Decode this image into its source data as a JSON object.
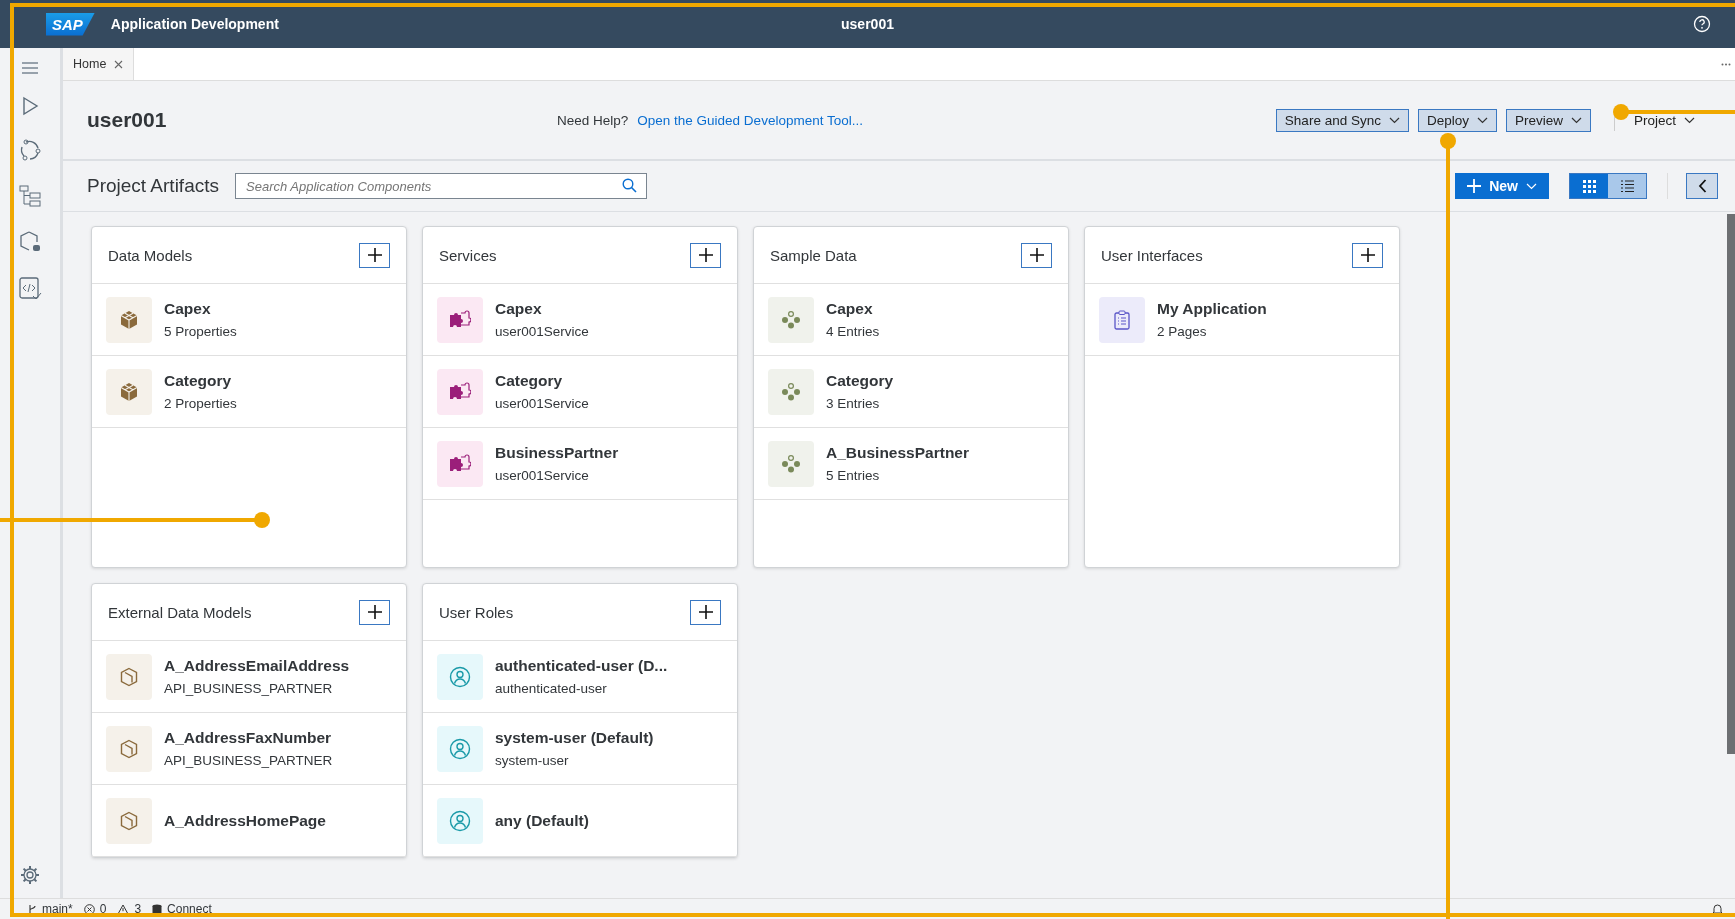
{
  "shell": {
    "logo": "SAP",
    "title": "Application Development",
    "user": "user001"
  },
  "tabs": [
    {
      "label": "Home",
      "selected": true
    }
  ],
  "header": {
    "title": "user001",
    "help_label": "Need Help?",
    "help_link": "Open the Guided Development Tool...",
    "buttons": [
      "Share and Sync",
      "Deploy",
      "Preview"
    ],
    "project_menu": "Project"
  },
  "artifacts": {
    "title": "Project Artifacts",
    "search_placeholder": "Search Application Components",
    "new_button": "New",
    "views": [
      {
        "kind": "grid",
        "selected": true
      },
      {
        "kind": "list",
        "selected": false
      }
    ]
  },
  "cards": [
    {
      "title": "Data Models",
      "kind": "entity",
      "items": [
        {
          "name": "Capex",
          "detail": "5 Properties"
        },
        {
          "name": "Category",
          "detail": "2 Properties"
        }
      ]
    },
    {
      "title": "Services",
      "kind": "service",
      "items": [
        {
          "name": "Capex",
          "detail": "user001Service"
        },
        {
          "name": "Category",
          "detail": "user001Service"
        },
        {
          "name": "BusinessPartner",
          "detail": "user001Service"
        }
      ]
    },
    {
      "title": "Sample Data",
      "kind": "sample",
      "items": [
        {
          "name": "Capex",
          "detail": "4 Entries"
        },
        {
          "name": "Category",
          "detail": "3 Entries"
        },
        {
          "name": "A_BusinessPartner",
          "detail": "5 Entries"
        }
      ]
    },
    {
      "title": "User Interfaces",
      "kind": "ui",
      "items": [
        {
          "name": "My Application",
          "detail": "2 Pages"
        }
      ]
    },
    {
      "title": "External Data Models",
      "kind": "external",
      "items": [
        {
          "name": "A_AddressEmailAddress",
          "detail": "API_BUSINESS_PARTNER"
        },
        {
          "name": "A_AddressFaxNumber",
          "detail": "API_BUSINESS_PARTNER"
        },
        {
          "name": "A_AddressHomePage"
        }
      ]
    },
    {
      "title": "User Roles",
      "kind": "role",
      "items": [
        {
          "name": "authenticated-user (D...",
          "detail": "authenticated-user"
        },
        {
          "name": "system-user (Default)",
          "detail": "system-user"
        },
        {
          "name": "any (Default)"
        }
      ]
    }
  ],
  "status_bar": {
    "branch": "main*",
    "errors": "0",
    "warnings": "3",
    "connection": "Connect"
  }
}
